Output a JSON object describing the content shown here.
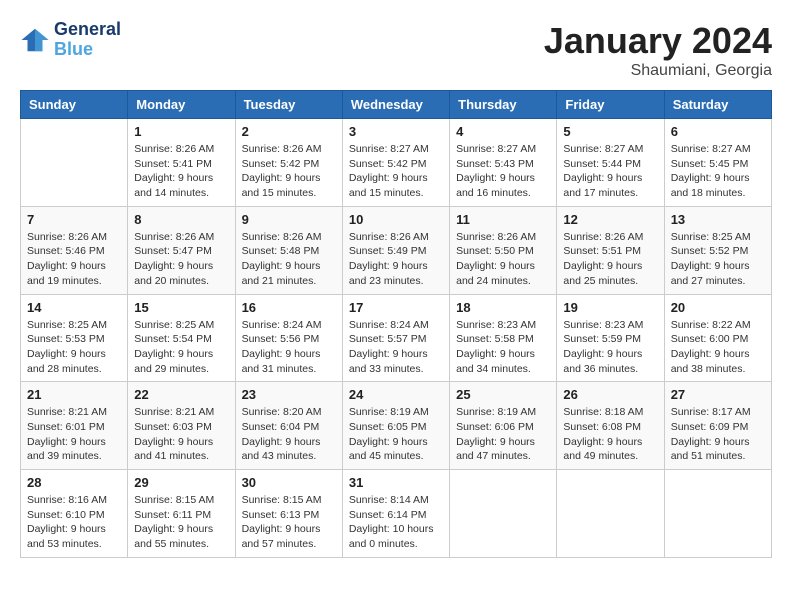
{
  "header": {
    "logo_line1": "General",
    "logo_line2": "Blue",
    "month_title": "January 2024",
    "location": "Shaumiani, Georgia"
  },
  "weekdays": [
    "Sunday",
    "Monday",
    "Tuesday",
    "Wednesday",
    "Thursday",
    "Friday",
    "Saturday"
  ],
  "weeks": [
    [
      {
        "day": "",
        "info": ""
      },
      {
        "day": "1",
        "info": "Sunrise: 8:26 AM\nSunset: 5:41 PM\nDaylight: 9 hours\nand 14 minutes."
      },
      {
        "day": "2",
        "info": "Sunrise: 8:26 AM\nSunset: 5:42 PM\nDaylight: 9 hours\nand 15 minutes."
      },
      {
        "day": "3",
        "info": "Sunrise: 8:27 AM\nSunset: 5:42 PM\nDaylight: 9 hours\nand 15 minutes."
      },
      {
        "day": "4",
        "info": "Sunrise: 8:27 AM\nSunset: 5:43 PM\nDaylight: 9 hours\nand 16 minutes."
      },
      {
        "day": "5",
        "info": "Sunrise: 8:27 AM\nSunset: 5:44 PM\nDaylight: 9 hours\nand 17 minutes."
      },
      {
        "day": "6",
        "info": "Sunrise: 8:27 AM\nSunset: 5:45 PM\nDaylight: 9 hours\nand 18 minutes."
      }
    ],
    [
      {
        "day": "7",
        "info": "Sunrise: 8:26 AM\nSunset: 5:46 PM\nDaylight: 9 hours\nand 19 minutes."
      },
      {
        "day": "8",
        "info": "Sunrise: 8:26 AM\nSunset: 5:47 PM\nDaylight: 9 hours\nand 20 minutes."
      },
      {
        "day": "9",
        "info": "Sunrise: 8:26 AM\nSunset: 5:48 PM\nDaylight: 9 hours\nand 21 minutes."
      },
      {
        "day": "10",
        "info": "Sunrise: 8:26 AM\nSunset: 5:49 PM\nDaylight: 9 hours\nand 23 minutes."
      },
      {
        "day": "11",
        "info": "Sunrise: 8:26 AM\nSunset: 5:50 PM\nDaylight: 9 hours\nand 24 minutes."
      },
      {
        "day": "12",
        "info": "Sunrise: 8:26 AM\nSunset: 5:51 PM\nDaylight: 9 hours\nand 25 minutes."
      },
      {
        "day": "13",
        "info": "Sunrise: 8:25 AM\nSunset: 5:52 PM\nDaylight: 9 hours\nand 27 minutes."
      }
    ],
    [
      {
        "day": "14",
        "info": "Sunrise: 8:25 AM\nSunset: 5:53 PM\nDaylight: 9 hours\nand 28 minutes."
      },
      {
        "day": "15",
        "info": "Sunrise: 8:25 AM\nSunset: 5:54 PM\nDaylight: 9 hours\nand 29 minutes."
      },
      {
        "day": "16",
        "info": "Sunrise: 8:24 AM\nSunset: 5:56 PM\nDaylight: 9 hours\nand 31 minutes."
      },
      {
        "day": "17",
        "info": "Sunrise: 8:24 AM\nSunset: 5:57 PM\nDaylight: 9 hours\nand 33 minutes."
      },
      {
        "day": "18",
        "info": "Sunrise: 8:23 AM\nSunset: 5:58 PM\nDaylight: 9 hours\nand 34 minutes."
      },
      {
        "day": "19",
        "info": "Sunrise: 8:23 AM\nSunset: 5:59 PM\nDaylight: 9 hours\nand 36 minutes."
      },
      {
        "day": "20",
        "info": "Sunrise: 8:22 AM\nSunset: 6:00 PM\nDaylight: 9 hours\nand 38 minutes."
      }
    ],
    [
      {
        "day": "21",
        "info": "Sunrise: 8:21 AM\nSunset: 6:01 PM\nDaylight: 9 hours\nand 39 minutes."
      },
      {
        "day": "22",
        "info": "Sunrise: 8:21 AM\nSunset: 6:03 PM\nDaylight: 9 hours\nand 41 minutes."
      },
      {
        "day": "23",
        "info": "Sunrise: 8:20 AM\nSunset: 6:04 PM\nDaylight: 9 hours\nand 43 minutes."
      },
      {
        "day": "24",
        "info": "Sunrise: 8:19 AM\nSunset: 6:05 PM\nDaylight: 9 hours\nand 45 minutes."
      },
      {
        "day": "25",
        "info": "Sunrise: 8:19 AM\nSunset: 6:06 PM\nDaylight: 9 hours\nand 47 minutes."
      },
      {
        "day": "26",
        "info": "Sunrise: 8:18 AM\nSunset: 6:08 PM\nDaylight: 9 hours\nand 49 minutes."
      },
      {
        "day": "27",
        "info": "Sunrise: 8:17 AM\nSunset: 6:09 PM\nDaylight: 9 hours\nand 51 minutes."
      }
    ],
    [
      {
        "day": "28",
        "info": "Sunrise: 8:16 AM\nSunset: 6:10 PM\nDaylight: 9 hours\nand 53 minutes."
      },
      {
        "day": "29",
        "info": "Sunrise: 8:15 AM\nSunset: 6:11 PM\nDaylight: 9 hours\nand 55 minutes."
      },
      {
        "day": "30",
        "info": "Sunrise: 8:15 AM\nSunset: 6:13 PM\nDaylight: 9 hours\nand 57 minutes."
      },
      {
        "day": "31",
        "info": "Sunrise: 8:14 AM\nSunset: 6:14 PM\nDaylight: 10 hours\nand 0 minutes."
      },
      {
        "day": "",
        "info": ""
      },
      {
        "day": "",
        "info": ""
      },
      {
        "day": "",
        "info": ""
      }
    ]
  ]
}
